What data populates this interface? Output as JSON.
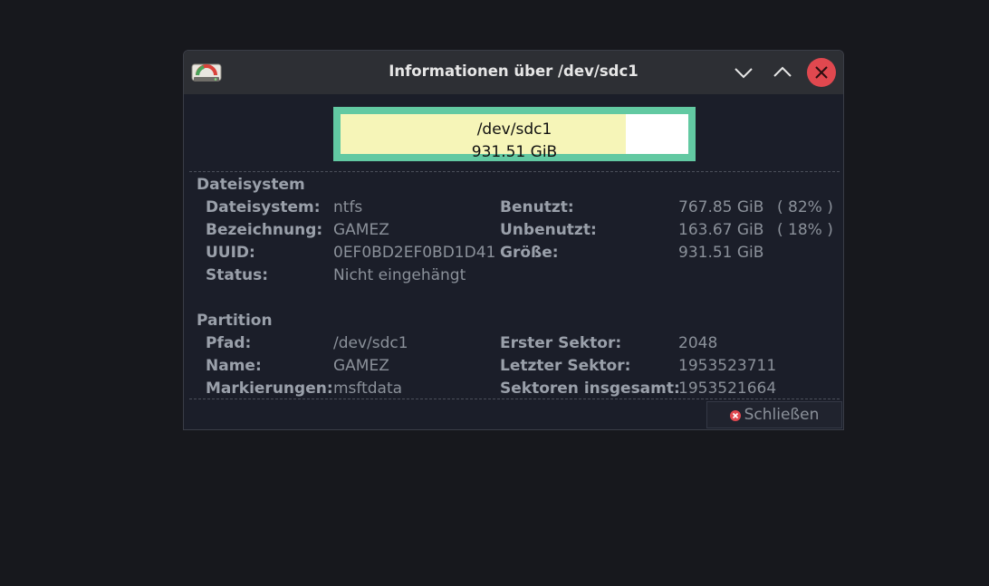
{
  "window": {
    "title": "Informationen über /dev/sdc1"
  },
  "partition_bar": {
    "path": "/dev/sdc1",
    "size": "931.51 GiB",
    "used_fraction": 0.82,
    "used_color": "#f6f5b8",
    "free_color": "#ffffff",
    "border_color": "#62c9a2"
  },
  "filesystem": {
    "heading": "Dateisystem",
    "left": [
      {
        "label": "Dateisystem:",
        "value": "ntfs"
      },
      {
        "label": "Bezeichnung:",
        "value": "GAMEZ"
      },
      {
        "label": "UUID:",
        "value": "0EF0BD2EF0BD1D41"
      },
      {
        "label": "Status:",
        "value": "Nicht eingehängt"
      }
    ],
    "right": [
      {
        "label": "Benutzt:",
        "value": "767.85 GiB",
        "percent": "( 82% )"
      },
      {
        "label": "Unbenutzt:",
        "value": "163.67 GiB",
        "percent": "( 18% )"
      },
      {
        "label": "Größe:",
        "value": "931.51 GiB",
        "percent": ""
      }
    ]
  },
  "partition": {
    "heading": "Partition",
    "left": [
      {
        "label": "Pfad:",
        "value": "/dev/sdc1"
      },
      {
        "label": "Name:",
        "value": "GAMEZ"
      },
      {
        "label": "Markierungen:",
        "value": "msftdata"
      }
    ],
    "right": [
      {
        "label": "Erster Sektor:",
        "value": "2048"
      },
      {
        "label": "Letzter Sektor:",
        "value": "1953523711"
      },
      {
        "label": "Sektoren insgesamt:",
        "value": "1953521664"
      }
    ]
  },
  "footer": {
    "close_label": "Schließen"
  },
  "icons": {
    "app": "gparted-icon",
    "minimize": "chevron-down-icon",
    "maximize": "chevron-up-icon",
    "close": "close-icon"
  },
  "colors": {
    "accent_close": "#e0484f"
  }
}
